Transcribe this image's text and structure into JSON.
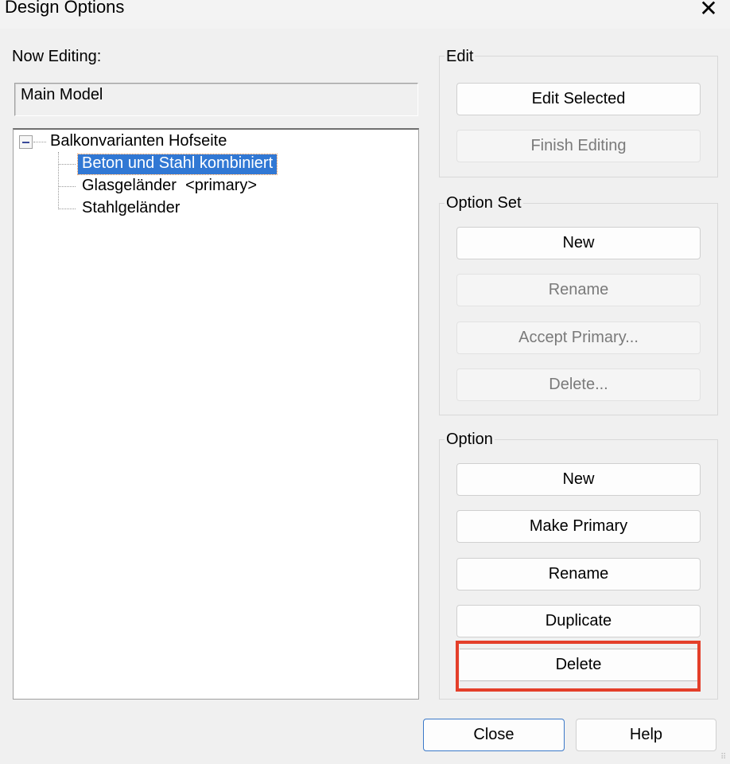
{
  "window": {
    "title": "Design Options",
    "close_icon": "close-icon"
  },
  "now_editing": {
    "label": "Now Editing:",
    "value": "Main Model"
  },
  "tree": {
    "root": "Balkonvarianten Hofseite",
    "items": [
      {
        "label": "Beton und Stahl kombiniert",
        "selected": true
      },
      {
        "label": "Glasgeländer  <primary>",
        "selected": false
      },
      {
        "label": "Stahlgeländer",
        "selected": false
      }
    ]
  },
  "edit_group": {
    "title": "Edit",
    "edit_selected": "Edit Selected",
    "finish_editing": "Finish Editing"
  },
  "option_set_group": {
    "title": "Option Set",
    "new": "New",
    "rename": "Rename",
    "accept_primary": "Accept Primary...",
    "delete": "Delete..."
  },
  "option_group": {
    "title": "Option",
    "new": "New",
    "make_primary": "Make Primary",
    "rename": "Rename",
    "duplicate": "Duplicate",
    "delete": "Delete"
  },
  "footer": {
    "close": "Close",
    "help": "Help"
  },
  "colors": {
    "highlight": "#e43f2a",
    "selection": "#3178d4"
  }
}
